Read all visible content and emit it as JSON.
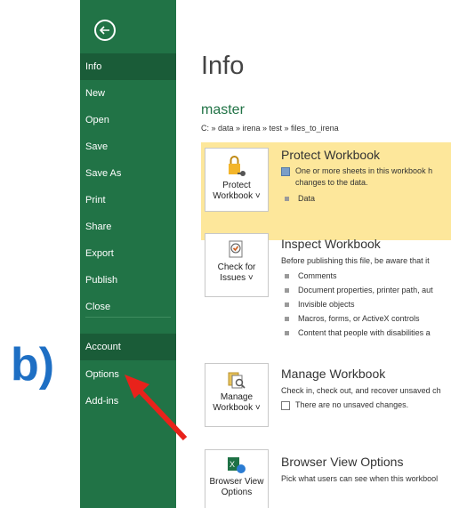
{
  "sidebar": {
    "back_label": "Back",
    "items": [
      {
        "label": "Info",
        "active": true
      },
      {
        "label": "New"
      },
      {
        "label": "Open"
      },
      {
        "label": "Save"
      },
      {
        "label": "Save As"
      },
      {
        "label": "Print"
      },
      {
        "label": "Share"
      },
      {
        "label": "Export"
      },
      {
        "label": "Publish"
      },
      {
        "label": "Close"
      }
    ],
    "account": "Account",
    "options": "Options",
    "addins": "Add-ins"
  },
  "main": {
    "title": "Info",
    "file_name": "master",
    "file_path": "C: » data » irena » test » files_to_irena",
    "protect": {
      "btn_line1": "Protect",
      "btn_line2": "Workbook ˅",
      "title": "Protect Workbook",
      "desc1": "One or more sheets in this workbook h",
      "desc2": "changes to the data.",
      "bullet": "Data"
    },
    "inspect": {
      "btn_line1": "Check for",
      "btn_line2": "Issues ˅",
      "title": "Inspect Workbook",
      "desc": "Before publishing this file, be aware that it",
      "bullets": [
        "Comments",
        "Document properties, printer path, aut",
        "Invisible objects",
        "Macros, forms, or ActiveX controls",
        "Content that people with disabilities a"
      ]
    },
    "manage": {
      "btn_line1": "Manage",
      "btn_line2": "Workbook ˅",
      "title": "Manage Workbook",
      "desc": "Check in, check out, and recover unsaved ch",
      "note": "There are no unsaved changes."
    },
    "browser": {
      "btn_line1": "Browser View",
      "btn_line2": "Options",
      "title": "Browser View Options",
      "desc": "Pick what users can see when this workbool"
    }
  },
  "annotation": {
    "label": "b)",
    "color": "#1e6fc4",
    "arrow_color": "#e8221b"
  },
  "colors": {
    "sidebar": "#217346",
    "highlight": "#fde79b"
  }
}
